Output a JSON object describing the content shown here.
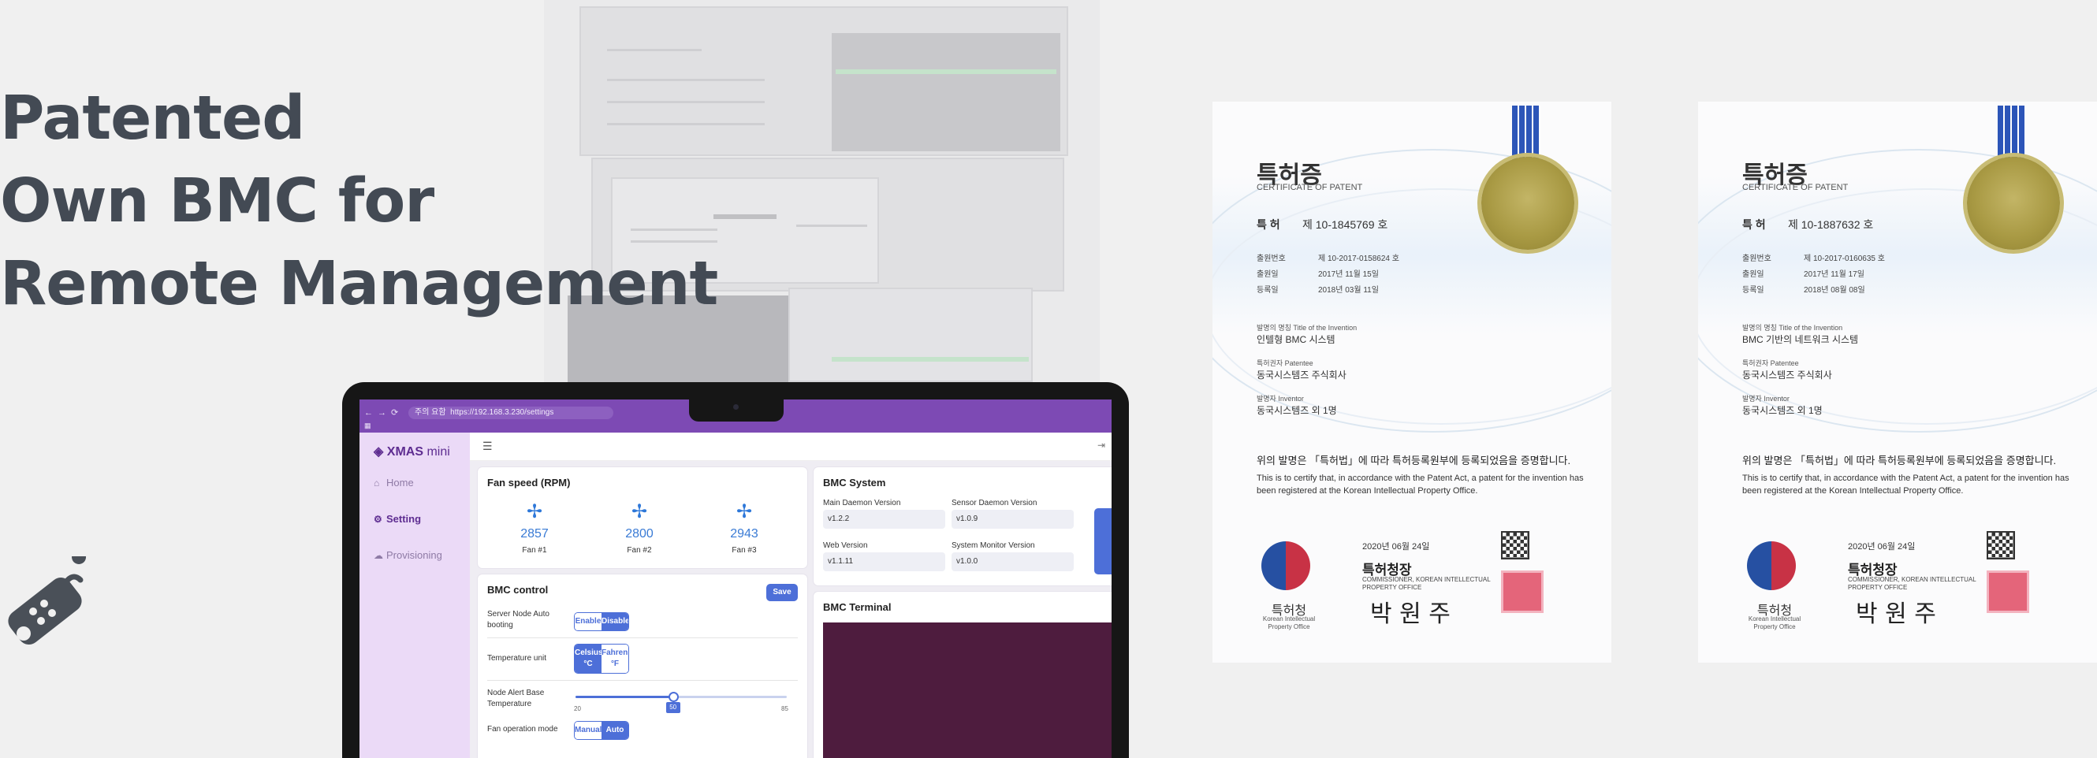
{
  "headline": {
    "line1": "Patented",
    "line2": "Own BMC for",
    "line3": "Remote Management"
  },
  "icons": {
    "remote": "remote-control-icon",
    "fan": "fan-icon"
  },
  "colors": {
    "headline": "#434a54",
    "brand_purple": "#7d4ab4",
    "primary_blue": "#4d6fd8",
    "sidebar_bg": "#ebdaf7",
    "terminal_bg": "#4e1c3e",
    "stamp_red": "#e14b64",
    "seal_gold": "#a99a44"
  },
  "browser": {
    "url": "https://192.168.3.230/settings",
    "secure_label": "주의 요함"
  },
  "app": {
    "brand": "XMAS",
    "brand_suffix": "mini",
    "sidebar": [
      {
        "label": "Home",
        "icon": "home-icon"
      },
      {
        "label": "Setting",
        "icon": "gear-icon"
      },
      {
        "label": "Provisioning",
        "icon": "cloud-upload-icon"
      }
    ]
  },
  "fan_speed": {
    "title": "Fan speed (RPM)",
    "fans": [
      {
        "rpm": "2857",
        "label": "Fan #1"
      },
      {
        "rpm": "2800",
        "label": "Fan #2"
      },
      {
        "rpm": "2943",
        "label": "Fan #3"
      }
    ]
  },
  "bmc_control": {
    "title": "BMC control",
    "save": "Save",
    "auto_boot_label": "Server Node Auto booting",
    "auto_boot_options": [
      "Enable",
      "Disable"
    ],
    "auto_boot_selected": "Disable",
    "temp_unit_label": "Temperature unit",
    "temp_unit_options": [
      "Celsius °C",
      "Fahrenheit °F"
    ],
    "temp_unit_selected": "Celsius °C",
    "alert_temp_label": "Node Alert Base Temperature",
    "alert_temp_min": "20",
    "alert_temp_max": "85",
    "alert_temp_value": "50",
    "fan_mode_label": "Fan operation mode",
    "fan_mode_options": [
      "Manual",
      "Auto"
    ],
    "fan_mode_selected": "Auto"
  },
  "bmc_system": {
    "title": "BMC System",
    "fields": [
      {
        "label": "Main Daemon Version",
        "value": "v1.2.2"
      },
      {
        "label": "Sensor Daemon Version",
        "value": "v1.0.9"
      },
      {
        "label": "Web Version",
        "value": "v1.1.11"
      },
      {
        "label": "System Monitor Version",
        "value": "v1.0.0"
      }
    ]
  },
  "bmc_terminal": {
    "title": "BMC Terminal"
  },
  "certificates": [
    {
      "title_ko": "특허증",
      "title_en": "CERTIFICATE OF PATENT",
      "number_label": "특 허",
      "number": "제 10-1845769 호",
      "app_no_label": "출원번호",
      "app_no": "제 10-2017-0158624 호",
      "filing_label": "출원일",
      "filing_date": "2017년 11월 15일",
      "reg_label": "등록일",
      "reg_date": "2018년 03월 11일",
      "invention": "발명의 명칭 Title of the Invention",
      "invention_value": "인텔형 BMC 시스템",
      "owner": "특허권자 Patentee",
      "owner_value": "동국시스템즈 주식회사",
      "inventor": "발명자 Inventor",
      "inventor_value": "동국시스템즈 외 1명",
      "statement_ko": "위의 발명은 「특허법」에 따라 특허등록원부에 등록되었음을 증명합니다.",
      "statement_en": "This is to certify that, in accordance with the Patent Act, a patent for the invention has been registered at the Korean Intellectual Property Office.",
      "issue_date": "2020년 06월 24일",
      "office_ko": "특허청장",
      "office_en": "COMMISSIONER, KOREAN INTELLECTUAL PROPERTY OFFICE",
      "signature": "박 원 주",
      "emblem_ko": "특허청",
      "emblem_en": "Korean Intellectual Property Office"
    },
    {
      "title_ko": "특허증",
      "title_en": "CERTIFICATE OF PATENT",
      "number_label": "특 허",
      "number": "제 10-1887632 호",
      "app_no_label": "출원번호",
      "app_no": "제 10-2017-0160635 호",
      "filing_label": "출원일",
      "filing_date": "2017년 11월 17일",
      "reg_label": "등록일",
      "reg_date": "2018년 08월 08일",
      "invention": "발명의 명칭 Title of the Invention",
      "invention_value": "BMC 기반의 네트워크 시스템",
      "owner": "특허권자 Patentee",
      "owner_value": "동국시스템즈 주식회사",
      "inventor": "발명자 Inventor",
      "inventor_value": "동국시스템즈 외 1명",
      "statement_ko": "위의 발명은 「특허법」에 따라 특허등록원부에 등록되었음을 증명합니다.",
      "statement_en": "This is to certify that, in accordance with the Patent Act, a patent for the invention has been registered at the Korean Intellectual Property Office.",
      "issue_date": "2020년 06월 24일",
      "office_ko": "특허청장",
      "office_en": "COMMISSIONER, KOREAN INTELLECTUAL PROPERTY OFFICE",
      "signature": "박 원 주",
      "emblem_ko": "특허청",
      "emblem_en": "Korean Intellectual Property Office"
    }
  ]
}
